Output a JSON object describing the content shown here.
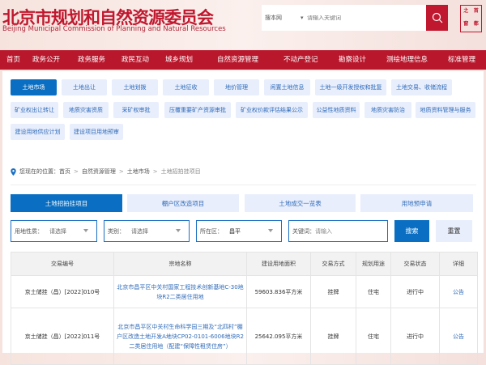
{
  "header": {
    "title": "北京市规划和自然资源委员会",
    "subtitle": "Beijing Municipal Commission of Planning and Natural Resources",
    "search_scope": "搜本网",
    "search_placeholder": "请输入关键词",
    "logo_chars": [
      "之",
      "首",
      "窗",
      "都"
    ]
  },
  "nav": [
    "首页",
    "政务公开",
    "政务服务",
    "政民互动",
    "城乡规划",
    "自然资源管理",
    "不动产登记",
    "勘察设计",
    "测绘地理信息",
    "标准管理"
  ],
  "subnav": [
    "土地市场",
    "土地出让",
    "土地划拨",
    "土地征收",
    "地价管理",
    "闲置土地信息",
    "土地一级开发授权和批复",
    "土地交易、收储流程",
    "矿业权出让转让",
    "地质灾害资质",
    "采矿权审批",
    "压覆重要矿产资源审批",
    "矿业权价款评估结果公示",
    "公益性地质资料",
    "地质灾害防治",
    "地质资料管理与服务",
    "建设用地供应计划",
    "建设项目用地预审"
  ],
  "breadcrumb": {
    "prefix": "您现在的位置：",
    "items": [
      "首页",
      "自然资源管理",
      "土地市场",
      "土地招拍挂项目"
    ]
  },
  "tabs": [
    "土地招拍挂项目",
    "棚户区改造项目",
    "土地成交一览表",
    "用地预申请"
  ],
  "filters": {
    "land_use": {
      "label": "用地性质：",
      "value": "请选择"
    },
    "category": {
      "label": "类别：",
      "value": "请选择"
    },
    "district": {
      "label": "所在区：",
      "value": "昌平"
    },
    "keyword": {
      "label": "关键词：",
      "placeholder": "请输入"
    },
    "search_label": "搜索",
    "reset_label": "重置"
  },
  "table": {
    "headers": [
      "交易编号",
      "宗地名称",
      "建设用地面积",
      "交易方式",
      "规划用途",
      "交易状态",
      "详细"
    ],
    "rows": [
      [
        "京土储挂（昌）[2022]010号",
        "北京市昌平区中关村国家工程技术创新基地C-30地块R2二类居住用地",
        "59603.836平方米",
        "挂牌",
        "住宅",
        "进行中",
        "公告"
      ],
      [
        "京土储挂（昌）[2022]011号",
        "北京市昌平区中关村生命科学园三期及“北四村”棚户区改造土地开发A地块CP02-0101-6006地块R2二类居住用地（配建“保障性租赁住房”）",
        "25642.095平方米",
        "挂牌",
        "住宅",
        "进行中",
        "公告"
      ]
    ]
  }
}
